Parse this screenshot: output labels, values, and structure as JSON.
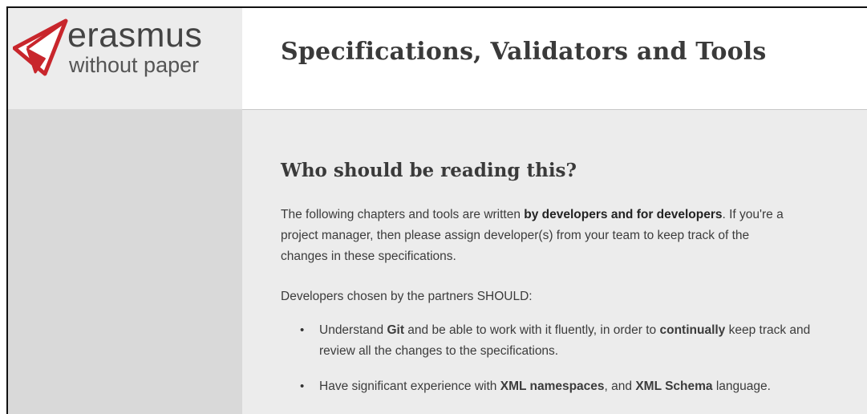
{
  "logo": {
    "line1": "erasmus",
    "line2": "without paper",
    "brand_color": "#c8262c",
    "icon": "paper-plane-icon"
  },
  "header": {
    "title": "Specifications, Validators and Tools"
  },
  "content": {
    "heading": "Who should be reading this?",
    "intro": {
      "before": "The following chapters and tools are written ",
      "bold": "by developers and for developers",
      "after_line1": ". If you're a",
      "line2": "project manager, then please assign developer(s) from your team to keep track of the",
      "line3": "changes in these specifications."
    },
    "lead": "Developers chosen by the partners SHOULD:",
    "items": [
      {
        "t1": "Understand ",
        "b1": "Git",
        "t2": " and be able to work with it fluently, in order to ",
        "b2": "continually",
        "t3": " keep track and",
        "line2": "review all the changes to the specifications."
      },
      {
        "t1": "Have significant experience with ",
        "b1": "XML namespaces",
        "t2": ", and ",
        "b2": "XML Schema",
        "t3": " language."
      }
    ]
  }
}
